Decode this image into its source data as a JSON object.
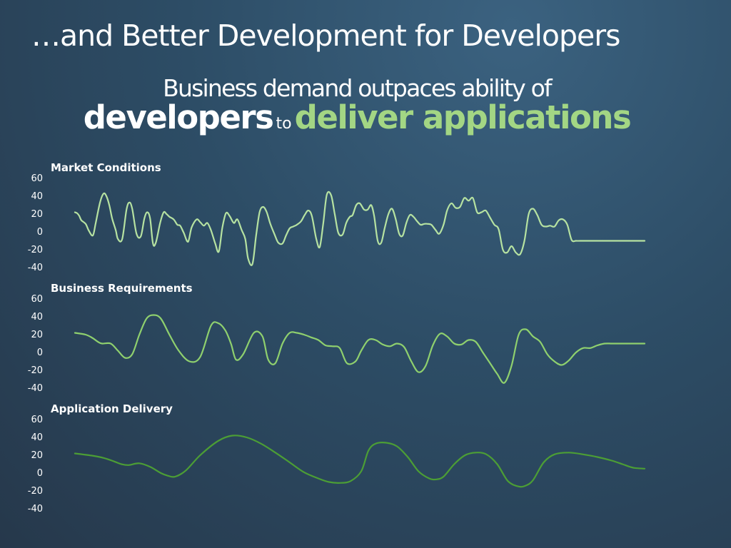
{
  "slide": {
    "title": "…and Better Development for Developers",
    "subtitle_line1": "Business demand outpaces ability of",
    "subtitle_word_developers": "developers",
    "subtitle_word_to": "to",
    "subtitle_word_deliver": "deliver applications"
  },
  "colors": {
    "accent_green": "#a3d684",
    "series_market": "#b6e2a1",
    "series_business": "#8fd06e",
    "series_delivery": "#4c9e35"
  },
  "chart_data": [
    {
      "type": "line",
      "title": "Market Conditions",
      "ylim": [
        -40,
        60
      ],
      "yticks": [
        60,
        40,
        20,
        0,
        -20,
        -40
      ],
      "ytick_labels": [
        "60",
        "40",
        "20",
        "0",
        "-20",
        "-40"
      ],
      "grid": false,
      "series": [
        {
          "color": "#b6e2a1",
          "x": [
            0,
            3,
            6,
            9,
            15,
            19,
            25,
            29,
            35,
            40,
            44,
            48,
            52,
            57,
            60,
            66,
            72,
            76,
            80,
            86,
            92,
            97,
            101,
            105,
            109,
            113,
            119,
            124,
            128,
            132,
            138,
            143,
            147,
            152,
            158,
            163,
            170,
            175,
            180,
            185,
            190,
            196,
            201,
            206,
            211,
            216,
            222,
            227,
            233,
            238,
            242,
            248,
            253,
            258,
            263,
            268,
            273,
            279,
            284,
            290,
            295,
            300,
            305,
            310,
            316,
            321,
            326,
            331,
            337,
            342,
            347,
            352,
            358,
            363,
            368,
            374,
            379,
            384,
            388,
            393,
            398,
            404,
            409,
            414,
            418,
            423,
            428,
            433,
            438,
            443,
            448,
            453,
            458,
            463,
            468,
            473,
            478,
            483,
            488,
            493,
            498,
            504,
            509,
            515,
            520,
            526,
            532,
            538,
            544,
            550,
            556,
            562,
            568,
            574,
            580,
            586,
            592,
            598,
            604,
            610,
            616,
            622,
            628,
            634,
            640,
            646,
            652,
            658,
            664,
            670,
            676,
            682,
            688,
            694,
            700,
            706,
            712,
            718,
            724,
            730,
            736,
            742,
            748,
            754,
            760,
            766,
            772,
            778,
            784,
            790,
            796
          ],
          "y": [
            22,
            21,
            18,
            13,
            9,
            2,
            -4,
            10,
            33,
            43,
            40,
            30,
            15,
            2,
            -8,
            -8,
            25,
            33,
            26,
            -2,
            -5,
            15,
            22,
            15,
            -13,
            -12,
            10,
            22,
            20,
            17,
            14,
            8,
            7,
            -1,
            -11,
            5,
            14,
            11,
            7,
            10,
            2,
            -13,
            -22,
            5,
            21,
            18,
            10,
            14,
            2,
            -8,
            -30,
            -36,
            -5,
            22,
            28,
            22,
            9,
            -3,
            -12,
            -13,
            -4,
            4,
            6,
            8,
            12,
            19,
            24,
            18,
            -7,
            -17,
            10,
            42,
            41,
            20,
            -1,
            -3,
            10,
            17,
            19,
            30,
            32,
            25,
            25,
            30,
            18,
            -10,
            -12,
            5,
            20,
            26,
            15,
            -2,
            -4,
            10,
            19,
            17,
            12,
            8,
            9,
            9,
            8,
            2,
            -2,
            8,
            24,
            32,
            27,
            28,
            38,
            35,
            38,
            22,
            22,
            24,
            16,
            8,
            3,
            -20,
            -23,
            -16,
            -23,
            -25,
            -10,
            20,
            26,
            19,
            8,
            6,
            7,
            6,
            13,
            14,
            8,
            -9,
            -10,
            -10,
            -10,
            -10,
            -10,
            -10,
            -10,
            -10,
            -10,
            -10,
            -10,
            -10,
            -10,
            -10,
            -10,
            -10,
            -10
          ]
        }
      ]
    },
    {
      "type": "line",
      "title": "Business Requirements",
      "ylim": [
        -40,
        60
      ],
      "yticks": [
        60,
        40,
        20,
        0,
        -20,
        -40
      ],
      "ytick_labels": [
        "60",
        "40",
        "20",
        "0",
        "-20",
        "-40"
      ],
      "grid": false,
      "series": [
        {
          "color": "#8fd06e",
          "x": [
            0,
            15,
            25,
            32,
            38,
            50,
            60,
            70,
            80,
            90,
            100,
            110,
            120,
            132,
            145,
            160,
            175,
            190,
            200,
            210,
            218,
            225,
            235,
            250,
            262,
            270,
            280,
            290,
            300,
            310,
            320,
            330,
            340,
            350,
            360,
            370,
            380,
            392,
            400,
            410,
            420,
            430,
            440,
            450,
            460,
            470,
            480,
            490,
            500,
            510,
            520,
            530,
            540,
            550,
            560,
            570,
            580,
            590,
            600,
            610,
            620,
            630,
            640,
            650,
            660,
            670,
            680,
            690,
            700,
            710,
            720,
            730,
            740,
            750,
            760,
            770,
            780,
            790,
            796
          ],
          "y": [
            22,
            20,
            16,
            12,
            10,
            10,
            2,
            -6,
            -2,
            20,
            38,
            42,
            38,
            20,
            2,
            -10,
            -5,
            30,
            33,
            25,
            10,
            -8,
            -2,
            22,
            18,
            -8,
            -12,
            10,
            22,
            22,
            20,
            17,
            14,
            8,
            7,
            5,
            -12,
            -10,
            2,
            14,
            14,
            9,
            7,
            10,
            6,
            -10,
            -22,
            -15,
            8,
            21,
            18,
            10,
            9,
            14,
            12,
            0,
            -12,
            -24,
            -34,
            -15,
            20,
            26,
            18,
            12,
            -2,
            -10,
            -14,
            -9,
            0,
            5,
            5,
            8,
            10,
            10,
            10,
            10,
            10,
            10,
            10
          ]
        }
      ]
    },
    {
      "type": "line",
      "title": "Application Delivery",
      "ylim": [
        -40,
        60
      ],
      "yticks": [
        60,
        40,
        20,
        0,
        -20,
        -40
      ],
      "ytick_labels": [
        "60",
        "40",
        "20",
        "0",
        "-20",
        "-40"
      ],
      "grid": false,
      "series": [
        {
          "color": "#4c9e35",
          "x": [
            0,
            20,
            40,
            55,
            65,
            75,
            90,
            105,
            120,
            130,
            140,
            155,
            175,
            200,
            220,
            240,
            260,
            280,
            300,
            320,
            340,
            355,
            370,
            385,
            400,
            410,
            420,
            435,
            450,
            465,
            480,
            495,
            505,
            515,
            530,
            545,
            560,
            575,
            590,
            605,
            620,
            630,
            640,
            655,
            670,
            690,
            710,
            730,
            750,
            765,
            780,
            796
          ],
          "y": [
            22,
            20,
            17,
            13,
            10,
            9,
            11,
            7,
            0,
            -3,
            -4,
            3,
            20,
            36,
            42,
            40,
            33,
            23,
            12,
            1,
            -6,
            -10,
            -11,
            -9,
            2,
            25,
            33,
            34,
            30,
            18,
            2,
            -6,
            -7,
            -4,
            10,
            20,
            23,
            21,
            10,
            -9,
            -15,
            -14,
            -8,
            12,
            21,
            23,
            21,
            18,
            14,
            10,
            6,
            5
          ]
        }
      ]
    }
  ]
}
